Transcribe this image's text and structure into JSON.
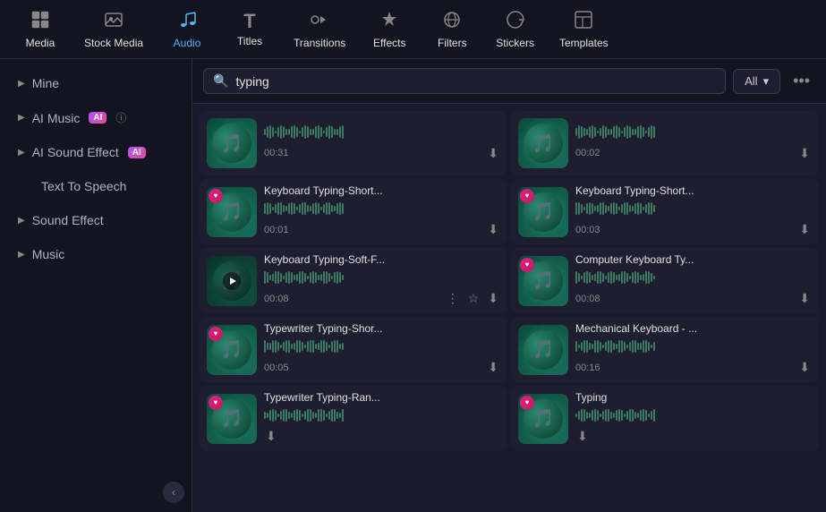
{
  "nav": {
    "items": [
      {
        "id": "media",
        "label": "Media",
        "icon": "⬛",
        "active": false
      },
      {
        "id": "stock-media",
        "label": "Stock Media",
        "icon": "🖼",
        "active": false
      },
      {
        "id": "audio",
        "label": "Audio",
        "icon": "🎵",
        "active": true
      },
      {
        "id": "titles",
        "label": "Titles",
        "icon": "T",
        "active": false
      },
      {
        "id": "transitions",
        "label": "Transitions",
        "icon": "↔",
        "active": false
      },
      {
        "id": "effects",
        "label": "Effects",
        "icon": "✨",
        "active": false
      },
      {
        "id": "filters",
        "label": "Filters",
        "icon": "🔮",
        "active": false
      },
      {
        "id": "stickers",
        "label": "Stickers",
        "icon": "⭐",
        "active": false
      },
      {
        "id": "templates",
        "label": "Templates",
        "icon": "⬜",
        "active": false
      }
    ]
  },
  "sidebar": {
    "items": [
      {
        "id": "mine",
        "label": "Mine",
        "hasArrow": true,
        "badge": null,
        "active": false
      },
      {
        "id": "ai-music",
        "label": "AI Music",
        "hasArrow": true,
        "badge": "AI",
        "active": false
      },
      {
        "id": "ai-sound-effect",
        "label": "AI Sound Effect",
        "hasArrow": true,
        "badge": "AI",
        "active": false
      },
      {
        "id": "text-to-speech",
        "label": "Text To Speech",
        "hasArrow": false,
        "badge": null,
        "active": false
      },
      {
        "id": "sound-effect",
        "label": "Sound Effect",
        "hasArrow": true,
        "badge": null,
        "active": false
      },
      {
        "id": "music",
        "label": "Music",
        "hasArrow": true,
        "badge": null,
        "active": false
      }
    ],
    "collapse_icon": "‹"
  },
  "search": {
    "placeholder": "Search",
    "value": "typing",
    "filter_label": "All",
    "more_icon": "•••"
  },
  "audio_items": [
    {
      "id": "a1",
      "title": "",
      "duration": "00:31",
      "has_heart": false,
      "has_play": false,
      "has_more": false,
      "has_star": false
    },
    {
      "id": "a2",
      "title": "",
      "duration": "00:02",
      "has_heart": false,
      "has_play": false,
      "has_more": false,
      "has_star": false
    },
    {
      "id": "a3",
      "title": "Keyboard Typing-Short...",
      "duration": "00:01",
      "has_heart": true,
      "has_play": false,
      "has_more": false,
      "has_star": false
    },
    {
      "id": "a4",
      "title": "Keyboard Typing-Short...",
      "duration": "00:03",
      "has_heart": true,
      "has_play": false,
      "has_more": false,
      "has_star": false
    },
    {
      "id": "a5",
      "title": "Keyboard Typing-Soft-F...",
      "duration": "00:08",
      "has_heart": false,
      "has_play": true,
      "has_more": true,
      "has_star": true
    },
    {
      "id": "a6",
      "title": "Computer Keyboard Ty...",
      "duration": "00:08",
      "has_heart": true,
      "has_play": false,
      "has_more": false,
      "has_star": false
    },
    {
      "id": "a7",
      "title": "Typewriter Typing-Shor...",
      "duration": "00:05",
      "has_heart": true,
      "has_play": false,
      "has_more": false,
      "has_star": false
    },
    {
      "id": "a8",
      "title": "Mechanical Keyboard - ...",
      "duration": "00:16",
      "has_heart": false,
      "has_play": false,
      "has_more": false,
      "has_star": false
    },
    {
      "id": "a9",
      "title": "Typewriter Typing-Ran...",
      "duration": "",
      "has_heart": true,
      "has_play": false,
      "has_more": false,
      "has_star": false
    },
    {
      "id": "a10",
      "title": "Typing",
      "duration": "",
      "has_heart": true,
      "has_play": false,
      "has_more": false,
      "has_star": false
    }
  ],
  "colors": {
    "active_nav": "#4db8ff",
    "heart_gradient_start": "#e91e8c",
    "heart_gradient_end": "#c2185b",
    "thumb_bg_start": "#0d4a3a",
    "thumb_bg_end": "#1a6b5a"
  }
}
